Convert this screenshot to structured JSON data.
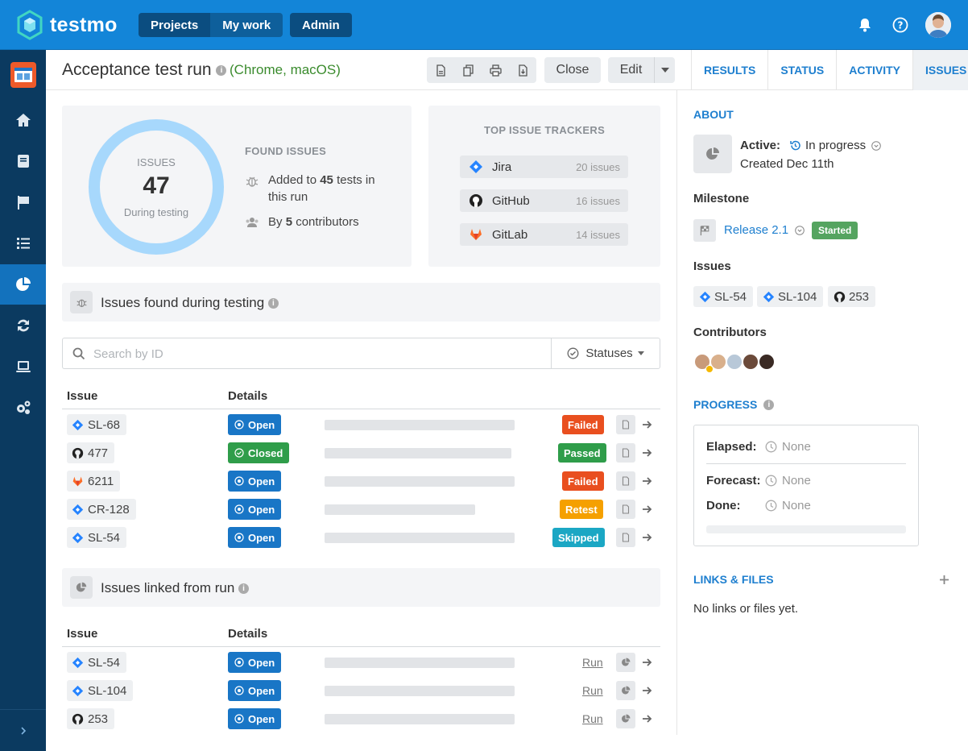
{
  "app": {
    "name": "testmo",
    "nav": [
      "Projects",
      "My work"
    ],
    "admin": "Admin"
  },
  "header": {
    "title": "Acceptance test run",
    "subtitle": "(Chrome, macOS)",
    "close_label": "Close",
    "edit_label": "Edit",
    "tabs": [
      "RESULTS",
      "STATUS",
      "ACTIVITY",
      "ISSUES"
    ],
    "active_tab": "ISSUES"
  },
  "summary": {
    "ring_title": "ISSUES",
    "ring_count": "47",
    "ring_sub": "During testing",
    "found_title": "FOUND ISSUES",
    "added_prefix": "Added to ",
    "added_count": "45",
    "added_suffix": " tests in",
    "added_line2": "this run",
    "by_prefix": "By ",
    "by_count": "5",
    "by_suffix": " contributors"
  },
  "trackers": {
    "title": "TOP ISSUE TRACKERS",
    "items": [
      {
        "name": "Jira",
        "count": "20 issues"
      },
      {
        "name": "GitHub",
        "count": "16 issues"
      },
      {
        "name": "GitLab",
        "count": "14 issues"
      }
    ]
  },
  "found_section": {
    "title": "Issues found during testing",
    "search_placeholder": "Search by ID",
    "statuses_label": "Statuses",
    "col_issue": "Issue",
    "col_details": "Details",
    "rows": [
      {
        "id": "SL-68",
        "tracker": "jira",
        "state": "Open",
        "status": "Failed",
        "skel": 236
      },
      {
        "id": "477",
        "tracker": "github",
        "state": "Closed",
        "status": "Passed",
        "skel": 232
      },
      {
        "id": "6211",
        "tracker": "gitlab",
        "state": "Open",
        "status": "Failed",
        "skel": 236
      },
      {
        "id": "CR-128",
        "tracker": "jira",
        "state": "Open",
        "status": "Retest",
        "skel": 187
      },
      {
        "id": "SL-54",
        "tracker": "jira",
        "state": "Open",
        "status": "Skipped",
        "skel": 236
      }
    ]
  },
  "linked_section": {
    "title": "Issues linked from run",
    "col_issue": "Issue",
    "col_details": "Details",
    "run_label": "Run",
    "rows": [
      {
        "id": "SL-54",
        "tracker": "jira",
        "state": "Open"
      },
      {
        "id": "SL-104",
        "tracker": "jira",
        "state": "Open"
      },
      {
        "id": "253",
        "tracker": "github",
        "state": "Open"
      }
    ]
  },
  "about": {
    "heading": "ABOUT",
    "active_label": "Active:",
    "active_value": "In progress",
    "created": "Created Dec 11th",
    "milestone_label": "Milestone",
    "milestone_value": "Release 2.1",
    "milestone_badge": "Started",
    "issues_label": "Issues",
    "issue_chips": [
      "SL-54",
      "SL-104",
      "253"
    ],
    "contributors_label": "Contributors"
  },
  "progress": {
    "heading": "PROGRESS",
    "elapsed_label": "Elapsed:",
    "elapsed_value": "None",
    "forecast_label": "Forecast:",
    "forecast_value": "None",
    "done_label": "Done:",
    "done_value": "None"
  },
  "links": {
    "heading": "LINKS & FILES",
    "empty": "No links or files yet."
  },
  "colors": {
    "brand": "#1385d8",
    "open": "#1976c6",
    "closed": "#2f9d4a",
    "failed": "#e94f1f",
    "passed": "#2f9d4a",
    "retest": "#f5a000",
    "skipped": "#1ba7c4",
    "started": "#55a460"
  }
}
